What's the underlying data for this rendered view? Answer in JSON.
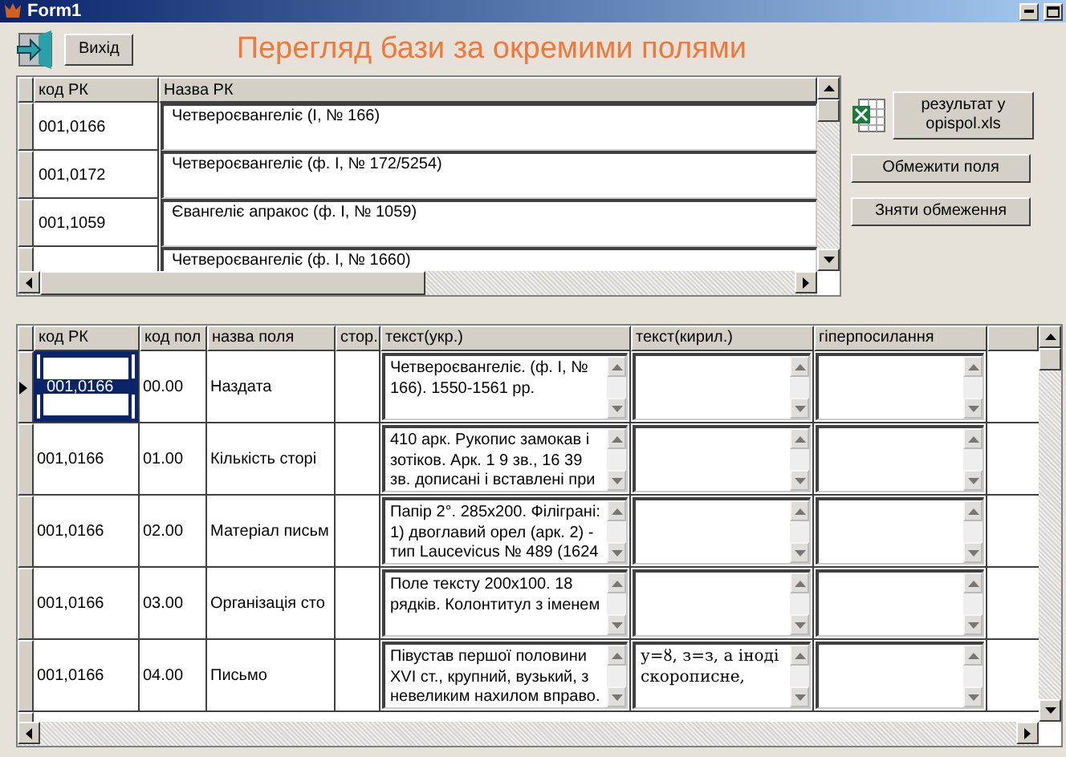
{
  "window": {
    "title": "Form1"
  },
  "toolbar": {
    "exit_button": "Вихід",
    "heading": "Перегляд бази за окремими полями"
  },
  "upper_grid": {
    "columns": [
      "код РК",
      "Назва РК"
    ],
    "rows": [
      {
        "selected": false,
        "code": "001,0166",
        "name": "Четвероєвангеліє (І, № 166)"
      },
      {
        "selected": false,
        "code": "001,0172",
        "name": "Четвероєвангеліє (ф. І, № 172/5254)"
      },
      {
        "selected": false,
        "code": "001,1059",
        "name": "Євангеліє апракос (ф. І, № 1059)"
      },
      {
        "selected": false,
        "name": "Четвероєвангеліє (ф. І, № 1660)"
      }
    ]
  },
  "side_buttons": [
    "результат у\nopispol.xls",
    "Обмежити поля",
    "Зняти обмеження"
  ],
  "lower_grid": {
    "columns": [
      "код РК",
      "код пол",
      "назва поля",
      "стор.",
      "текст(укр.)",
      "текст(кирил.)",
      "гіперпосилання"
    ],
    "rows": [
      {
        "selected": true,
        "code": "001,0166",
        "field_code": "00.00",
        "field_name": "Наздата",
        "text_ukr": "Четвероєвангеліє. (ф. І, №\n166). 1550-1561 рр."
      },
      {
        "selected": false,
        "code": "001,0166",
        "field_code": "01.00",
        "field_name": "Кількість сторі",
        "text_ukr": "410 арк. Рукопис замокав і\nзотіков. Арк. 1 9 зв., 16 39\nзв. дописані і вставлені при"
      },
      {
        "selected": false,
        "code": "001,0166",
        "field_code": "02.00",
        "field_name": "Матеріал письм",
        "text_ukr": "Папір 2°. 285х200. Філіграні:\n1) двоглавий орел (арк. 2) -\nтип Laucevicus № 489 (1624"
      },
      {
        "selected": false,
        "code": "001,0166",
        "field_code": "03.00",
        "field_name": "Організація сто",
        "text_ukr": "Поле тексту 200х100. 18\nрядків. Колонтитул з іменем"
      },
      {
        "selected": false,
        "code": "001,0166",
        "field_code": "04.00",
        "field_name": "Письмо",
        "text_ukr": "Півустав першої половини\nXVI ст., крупний, вузький, з\nневеликим нахилом вправо.",
        "text_kiril": "у=ȣ, з=з, а іноді\nскорописне,"
      }
    ]
  }
}
